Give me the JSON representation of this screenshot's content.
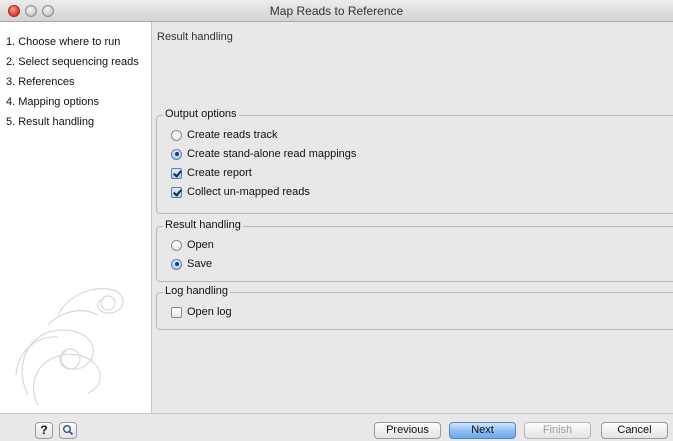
{
  "window": {
    "title": "Map Reads to Reference"
  },
  "sidebar": {
    "steps": [
      "1. Choose where to run",
      "2. Select sequencing reads",
      "3. References",
      "4. Mapping options",
      "5. Result handling"
    ]
  },
  "main": {
    "section_title": "Result handling",
    "output_options": {
      "legend": "Output options",
      "options": [
        {
          "label": "Create reads track",
          "type": "radio",
          "checked": false
        },
        {
          "label": "Create stand-alone read mappings",
          "type": "radio",
          "checked": true
        },
        {
          "label": "Create report",
          "type": "checkbox",
          "checked": true
        },
        {
          "label": "Collect un-mapped reads",
          "type": "checkbox",
          "checked": true
        }
      ]
    },
    "result_handling": {
      "legend": "Result handling",
      "options": [
        {
          "label": "Open",
          "type": "radio",
          "checked": false
        },
        {
          "label": "Save",
          "type": "radio",
          "checked": true
        }
      ]
    },
    "log_handling": {
      "legend": "Log handling",
      "options": [
        {
          "label": "Open log",
          "type": "checkbox",
          "checked": false
        }
      ]
    }
  },
  "footer": {
    "help_label": "?",
    "previous_label": "Previous",
    "next_label": "Next",
    "finish_label": "Finish",
    "cancel_label": "Cancel"
  },
  "colors": {
    "default_button": "#8ebdf0",
    "background": "#e8e8e8"
  }
}
